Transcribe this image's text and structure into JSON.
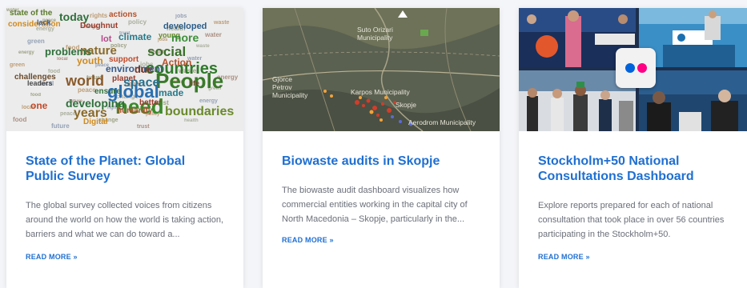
{
  "cards": [
    {
      "title": "State of the Planet: Global Public Survey",
      "description": "The global survey collected voices from citizens around the world on how the world is taking action, barriers and what we can do toward a...",
      "link_label": "READ MORE »",
      "wordcloud": [
        "state of the",
        "today",
        "actions",
        "consideration",
        "lack",
        "Doughnut",
        "developed",
        "climate",
        "young",
        "more",
        "lot",
        "problems",
        "nature",
        "social",
        "countries",
        "youth",
        "support",
        "Action",
        "environment",
        "due",
        "People",
        "challenges",
        "world",
        "planet",
        "space",
        "leaders",
        "global",
        "need",
        "one",
        "developing",
        "humanity",
        "years",
        "boundaries",
        "Digital",
        "made",
        "better",
        "ensure",
        "life"
      ]
    },
    {
      "title": "Biowaste audits in Skopje",
      "description": "The biowaste audit dashboard visualizes how commercial entities working in the capital city of North Macedonia – Skopje, particularly in the...",
      "link_label": "READ MORE »",
      "map_labels": [
        "Suto Orizari\nMunicipality",
        "Gjorce\nPetrov\nMunicipality",
        "Karpos Municipality",
        "Skopje",
        "Aerodrom Municipality"
      ]
    },
    {
      "title": "Stockholm+50 National Consultations Dashboard",
      "description": "Explore reports prepared for each of national consultation that took place in over 56 countries participating in the Stockholm+50.",
      "link_label": "READ MORE »",
      "flickr_icon": "flickr-logo-icon",
      "flickr_colors": [
        "#0063dc",
        "#ff0084"
      ]
    }
  ]
}
